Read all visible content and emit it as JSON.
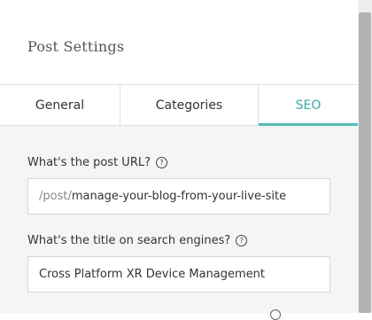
{
  "panel": {
    "title": "Post Settings"
  },
  "tabs": [
    {
      "label": "General",
      "active": false
    },
    {
      "label": "Categories",
      "active": false
    },
    {
      "label": "SEO",
      "active": true
    }
  ],
  "seo": {
    "url_label": "What's the post URL?",
    "url_prefix": "/post/",
    "url_slug": "manage-your-blog-from-your-live-site",
    "title_label": "What's the title on search engines?",
    "title_value": "Cross Platform XR Device Management"
  },
  "icons": {
    "help": "?"
  },
  "colors": {
    "accent": "#4fbdb5",
    "accent_text": "#3aaaa3",
    "content_bg": "#f5f5f5"
  }
}
